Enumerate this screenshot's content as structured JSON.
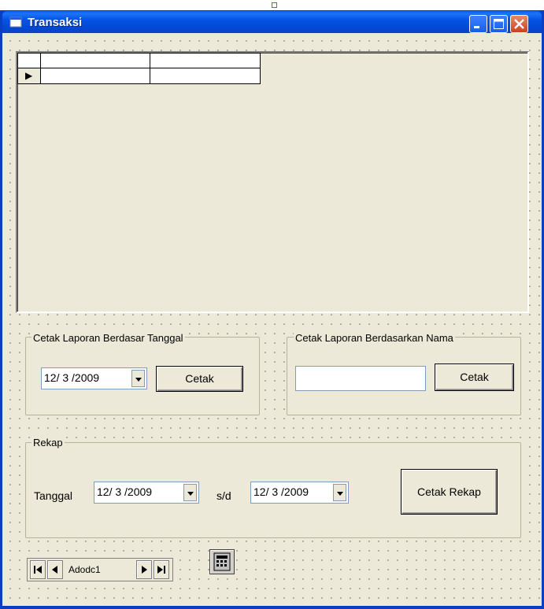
{
  "window": {
    "title": "Transaksi"
  },
  "grid": {
    "row_indicator": "▶",
    "columns": [
      "",
      ""
    ],
    "rows": [
      [
        "",
        ""
      ]
    ]
  },
  "frame_tanggal": {
    "legend": "Cetak Laporan Berdasar Tanggal",
    "date_value": "12/ 3 /2009",
    "button": "Cetak"
  },
  "frame_nama": {
    "legend": "Cetak Laporan Berdasarkan Nama",
    "name_value": "",
    "button": "Cetak"
  },
  "frame_rekap": {
    "legend": "Rekap",
    "label_tanggal": "Tanggal",
    "date_from": "12/ 3 /2009",
    "label_sd": "s/d",
    "date_to": "12/ 3 /2009",
    "button": "Cetak Rekap"
  },
  "adodc": {
    "caption": "Adodc1"
  },
  "icons": {
    "minimize": "minimize-icon",
    "maximize": "maximize-icon",
    "close": "close-icon",
    "report": "report-component-icon"
  },
  "colors": {
    "titlebar": "#0553e4",
    "form_bg": "#ece9d8",
    "close_btn": "#c84223"
  }
}
